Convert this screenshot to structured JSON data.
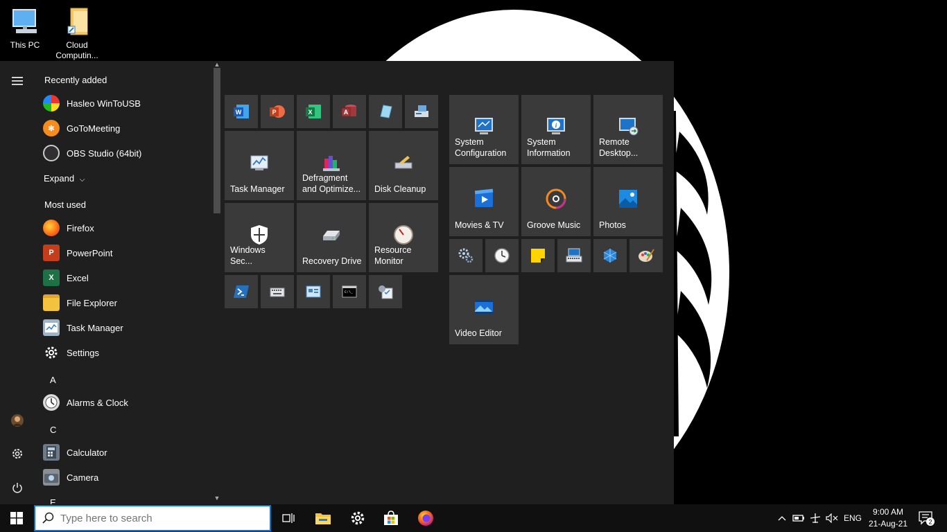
{
  "desktop": {
    "icons": [
      {
        "label": "This PC",
        "icon": "computer-icon"
      },
      {
        "label": "Cloud Computin...",
        "icon": "folder-shortcut-icon"
      }
    ]
  },
  "start_menu": {
    "rail": {
      "hamburger": "menu-icon",
      "user": "user-avatar",
      "settings": "gear-icon",
      "power": "power-icon"
    },
    "recently_added": {
      "heading": "Recently added",
      "items": [
        "Hasleo WinToUSB",
        "GoToMeeting",
        "OBS Studio (64bit)"
      ]
    },
    "expand_label": "Expand",
    "most_used": {
      "heading": "Most used",
      "items": [
        "Firefox",
        "PowerPoint",
        "Excel",
        "File Explorer",
        "Task Manager",
        "Settings"
      ]
    },
    "groups": [
      {
        "letter": "A",
        "items": [
          "Alarms & Clock"
        ]
      },
      {
        "letter": "C",
        "items": [
          "Calculator",
          "Camera"
        ]
      },
      {
        "letter": "E",
        "items": []
      }
    ],
    "tiles": {
      "left_group": {
        "small_row1": [
          "Word",
          "PowerPoint",
          "Excel",
          "Access",
          "Snipping",
          "Scanner"
        ],
        "medium_row1": [
          "Task Manager",
          "Defragment and Optimize...",
          "Disk Cleanup"
        ],
        "medium_row2": [
          "Windows Sec...",
          "Recovery Drive",
          "Resource Monitor"
        ],
        "small_row2": [
          "PowerShell",
          "Keyboard",
          "Control Panel",
          "Command Prompt",
          "Task Scheduler"
        ]
      },
      "right_group": {
        "medium_row1": [
          "System Configuration",
          "System Information",
          "Remote Desktop..."
        ],
        "medium_row2": [
          "Movies & TV",
          "Groove Music",
          "Photos"
        ],
        "small_row": [
          "Settings",
          "Clock",
          "Sticky Notes",
          "On-Screen Keyboard",
          "3D Builder",
          "Paint"
        ],
        "medium_row3": [
          "Video Editor"
        ]
      }
    }
  },
  "taskbar": {
    "search_placeholder": "Type here to search",
    "pinned": [
      "task-view-icon",
      "file-explorer-icon",
      "settings-icon",
      "store-icon",
      "firefox-icon"
    ],
    "tray": {
      "language": "ENG",
      "time": "9:00 AM",
      "date": "21-Aug-21",
      "notifications": "2"
    }
  },
  "colors": {
    "accent": "#0078d7",
    "menu_bg": "#1f1f1f",
    "tile_bg": "#3a3a3a",
    "taskbar_bg": "#101010"
  }
}
